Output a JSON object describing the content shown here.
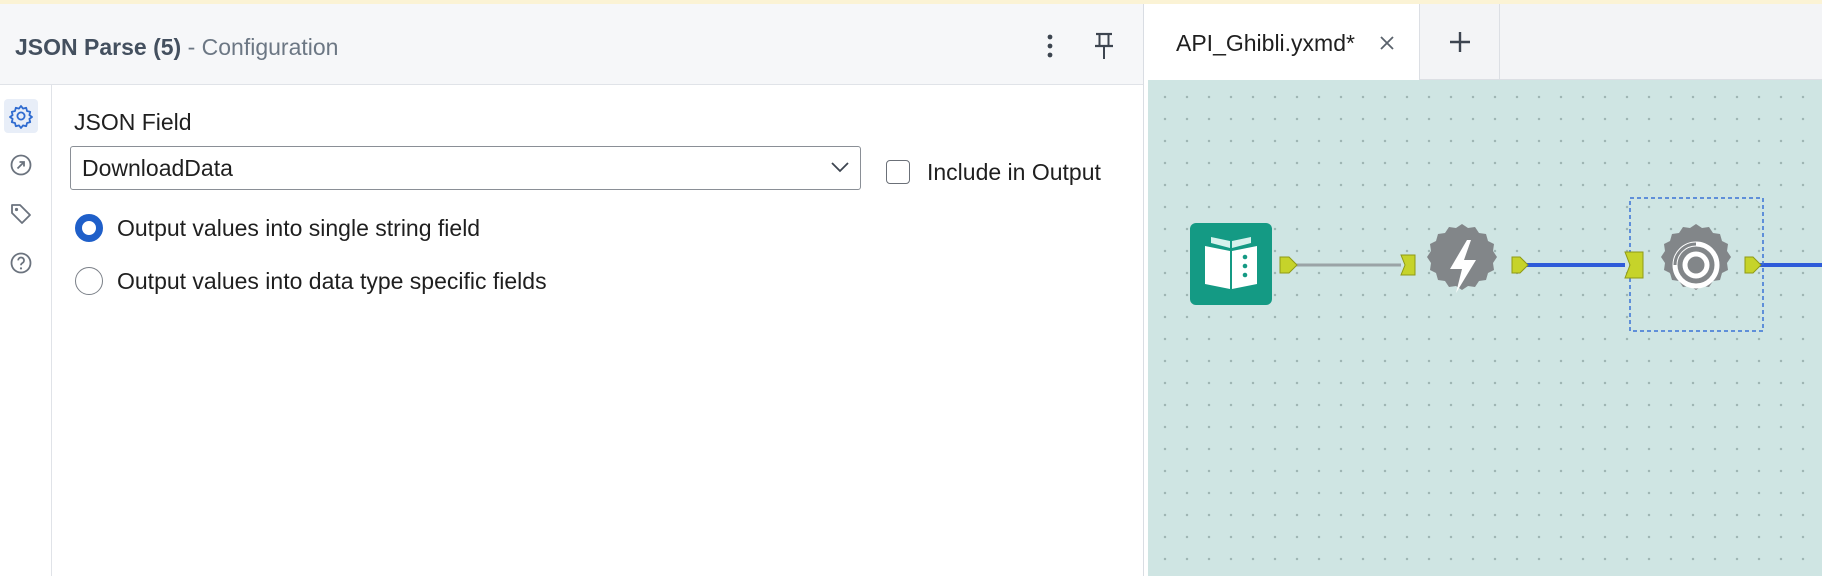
{
  "config": {
    "tool_name": "JSON Parse (5)",
    "subtitle": "- Configuration",
    "json_field_label": "JSON Field",
    "json_field_value": "DownloadData",
    "include_in_output_label": "Include in Output",
    "include_in_output_checked": false,
    "radio_options": [
      {
        "label": "Output values into single string field",
        "selected": true
      },
      {
        "label": "Output values into data type specific fields",
        "selected": false
      }
    ],
    "side_rail_icons": [
      "gear-icon",
      "annotation-icon",
      "tag-icon",
      "help-icon"
    ]
  },
  "tabs": [
    {
      "label": "API_Ghibli.yxmd*",
      "active": true,
      "close_symbol": "×"
    }
  ],
  "add_tab_symbol": "+",
  "canvas": {
    "tools": [
      {
        "name": "input-data-tool",
        "icon": "book-icon",
        "color": "#149a84"
      },
      {
        "name": "download-tool",
        "icon": "lightning-icon",
        "color": "#828689"
      },
      {
        "name": "json-parse-tool",
        "icon": "json-parse-icon",
        "color": "#828689",
        "selected": true
      }
    ],
    "colors": {
      "background": "#cfe5e3",
      "connector": "#c6d32a",
      "wire_grey": "#9aa3a6",
      "wire_blue": "#2e5bd9",
      "selection": "#3a73d6"
    }
  }
}
